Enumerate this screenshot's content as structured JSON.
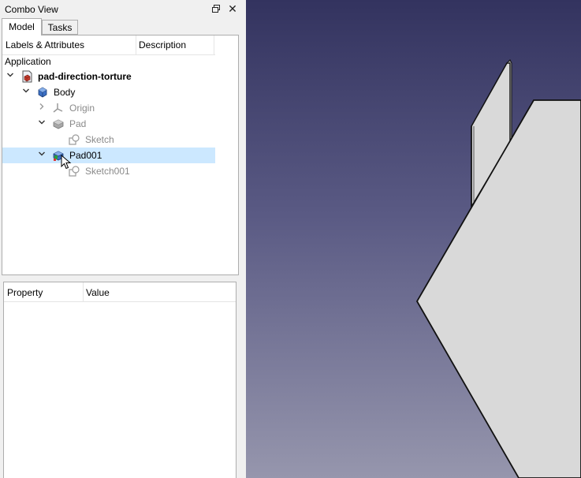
{
  "combo_view": {
    "title": "Combo View",
    "float_icon": "float-window-icon",
    "close_icon": "close-icon",
    "tabs": [
      {
        "label": "Model",
        "active": true
      },
      {
        "label": "Tasks",
        "active": false
      }
    ]
  },
  "tree": {
    "columns": [
      "Labels & Attributes",
      "Description"
    ],
    "root_label": "Application",
    "items": [
      {
        "label": "pad-direction-torture",
        "icon": "document-icon",
        "expanded": true
      },
      {
        "label": "Body",
        "icon": "body-icon",
        "expanded": true
      },
      {
        "label": "Origin",
        "icon": "origin-icon",
        "expanded": false,
        "dimmed": true
      },
      {
        "label": "Pad",
        "icon": "pad-icon",
        "expanded": true,
        "dimmed": true
      },
      {
        "label": "Sketch",
        "icon": "sketch-icon",
        "dimmed": true
      },
      {
        "label": "Pad001",
        "icon": "pad-icon",
        "expanded": true,
        "selected": true
      },
      {
        "label": "Sketch001",
        "icon": "sketch-icon",
        "dimmed": true
      }
    ]
  },
  "property_view": {
    "columns": [
      "Property",
      "Value"
    ]
  },
  "colors": {
    "selection": "#cce8ff",
    "viewport_top": "#33335f",
    "viewport_bottom": "#9696ad",
    "model_face": "#d9d9d9"
  }
}
